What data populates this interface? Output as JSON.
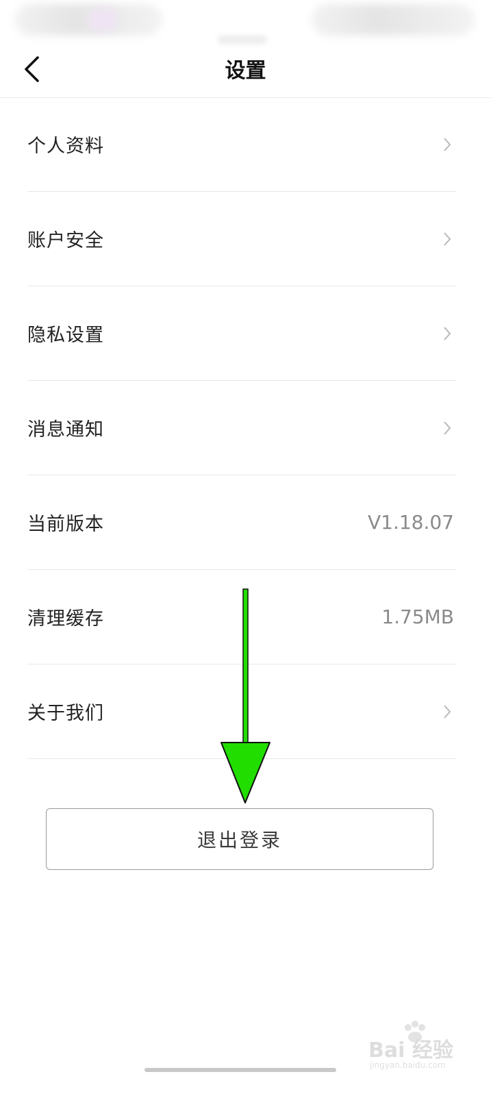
{
  "nav": {
    "title": "设置",
    "back_icon": "chevron-left-icon"
  },
  "menu": [
    {
      "label": "个人资料",
      "value": "",
      "trailing": "chevron-right-icon"
    },
    {
      "label": "账户安全",
      "value": "",
      "trailing": "chevron-right-icon"
    },
    {
      "label": "隐私设置",
      "value": "",
      "trailing": "chevron-right-icon"
    },
    {
      "label": "消息通知",
      "value": "",
      "trailing": "chevron-right-icon"
    },
    {
      "label": "当前版本",
      "value": "V1.18.07",
      "trailing": ""
    },
    {
      "label": "清理缓存",
      "value": "1.75MB",
      "trailing": ""
    },
    {
      "label": "关于我们",
      "value": "",
      "trailing": "chevron-right-icon"
    }
  ],
  "logout": {
    "label": "退出登录"
  },
  "annotation": {
    "arrow_color": "#22dd00",
    "icon": "down-arrow-icon"
  },
  "watermark": {
    "text": "Bai 经验",
    "sub": "jingyan.baidu.com"
  },
  "colors": {
    "value_text": "#8a8a8a",
    "divider": "#e8e8e8",
    "chevron": "#b8b8b8"
  }
}
